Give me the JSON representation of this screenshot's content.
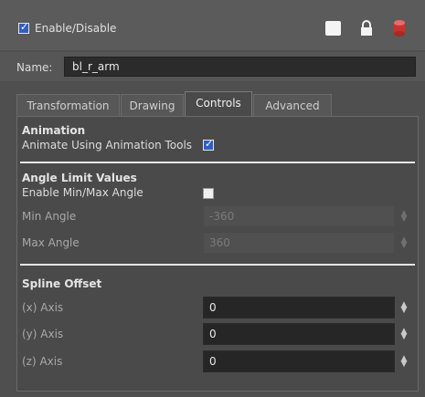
{
  "header": {
    "enable_label": "Enable/Disable",
    "enabled": true,
    "icons": [
      "color-swatch-icon",
      "lock-icon",
      "layer-stack-icon"
    ]
  },
  "name": {
    "label": "Name:",
    "value": "bl_r_arm"
  },
  "tabs": [
    {
      "label": "Transformation",
      "active": false
    },
    {
      "label": "Drawing",
      "active": false
    },
    {
      "label": "Controls",
      "active": true
    },
    {
      "label": "Advanced",
      "active": false
    }
  ],
  "animation": {
    "title": "Animation",
    "animate_label": "Animate Using Animation Tools",
    "animate_checked": true
  },
  "angle": {
    "title": "Angle Limit Values",
    "enable_label": "Enable Min/Max Angle",
    "enable_checked": false,
    "min_label": "Min Angle",
    "min_value": "-360",
    "max_label": "Max Angle",
    "max_value": "360"
  },
  "spline": {
    "title": "Spline Offset",
    "x_label": "(x) Axis",
    "x_value": "0",
    "y_label": "(y) Axis",
    "y_value": "0",
    "z_label": "(z) Axis",
    "z_value": "0"
  },
  "colors": {
    "panel": "#4f4f4f",
    "field_dark": "#262626",
    "checkbox_blue": "#2f5fbf",
    "divider": "#e6e6e6",
    "layer_icon": "#c8332f"
  }
}
